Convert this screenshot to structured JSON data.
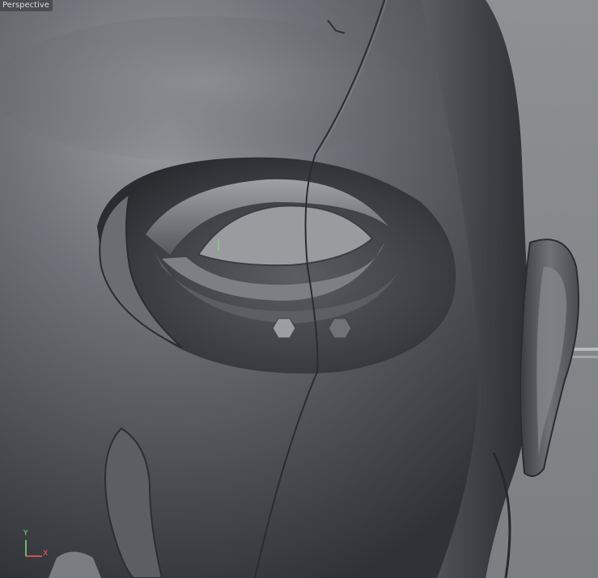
{
  "viewport": {
    "name": "Perspective",
    "view_type": "3d-sculpt",
    "colors": {
      "background": "#8c8e91",
      "model_mid": "#6c7074",
      "model_dark": "#2c3033",
      "label_bg": "#4a4d50",
      "label_text": "#d8dadc"
    }
  },
  "axis_gizmo": {
    "y_label": "Y",
    "x_label": "X",
    "y_color": "#7fe07f",
    "x_color": "#ff5a5a"
  },
  "model": {
    "subject": "head-mesh",
    "handles": [
      "selection-handle",
      "selection-handle"
    ]
  }
}
